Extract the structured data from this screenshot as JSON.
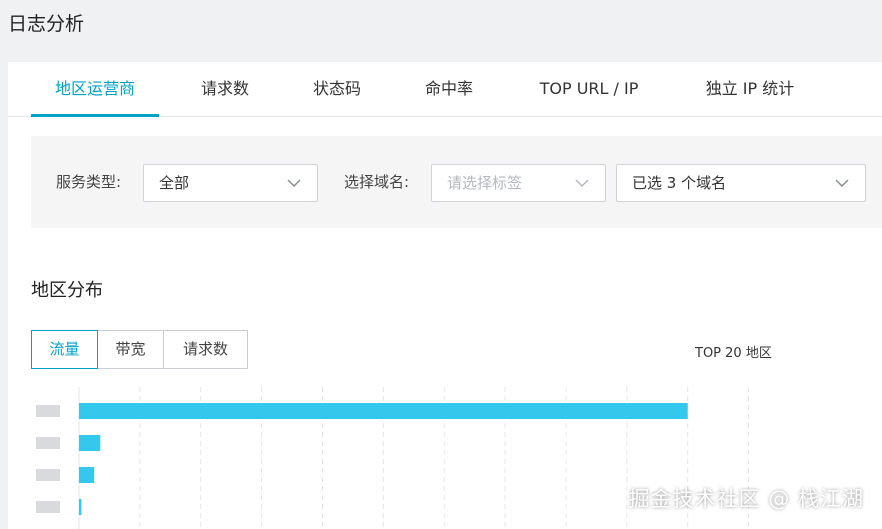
{
  "page": {
    "title": "日志分析"
  },
  "tabs": [
    {
      "label": "地区运营商",
      "active": true
    },
    {
      "label": "请求数",
      "active": false
    },
    {
      "label": "状态码",
      "active": false
    },
    {
      "label": "命中率",
      "active": false
    },
    {
      "label": "TOP URL / IP",
      "active": false
    },
    {
      "label": "独立 IP 统计",
      "active": false
    }
  ],
  "filters": {
    "service_type": {
      "label": "服务类型:",
      "value": "全部"
    },
    "domain": {
      "label": "选择域名:",
      "placeholder": "请选择标签",
      "selected": "已选 3 个域名"
    }
  },
  "region": {
    "title": "地区分布",
    "metric_tabs": [
      {
        "label": "流量",
        "active": true
      },
      {
        "label": "带宽",
        "active": false
      },
      {
        "label": "请求数",
        "active": false
      }
    ],
    "top_label": "TOP 20 地区"
  },
  "chart_data": {
    "type": "bar",
    "orientation": "horizontal",
    "categories": [
      "",
      "",
      "",
      ""
    ],
    "values": [
      100,
      3.5,
      2.5,
      0.4
    ],
    "xlim": [
      0,
      115
    ],
    "grid": true,
    "bar_color": "#33c8ec"
  },
  "watermark": "掘金技术社区 @ 栈江湖",
  "colors": {
    "accent": "#00a2ca",
    "bar": "#33c8ec",
    "background": "#f0f1f3"
  }
}
